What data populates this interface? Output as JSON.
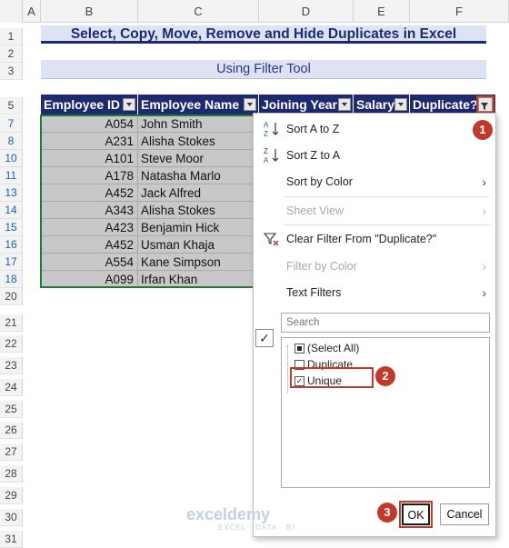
{
  "columns": [
    "A",
    "B",
    "C",
    "D",
    "E",
    "F"
  ],
  "rows": [
    "1",
    "2",
    "3",
    "5",
    "7",
    "8",
    "10",
    "11",
    "13",
    "14",
    "15",
    "16",
    "17",
    "18",
    "20",
    "21",
    "22",
    "23",
    "24",
    "25",
    "26",
    "27",
    "28",
    "29",
    "30",
    "31"
  ],
  "title": "Select, Copy, Move, Remove and Hide Duplicates in Excel",
  "subtitle": "Using Filter Tool",
  "headers": [
    "Employee ID",
    "Employee Name",
    "Joining Year",
    "Salary",
    "Duplicate?"
  ],
  "table": [
    {
      "id": "A054",
      "name": "John Smith"
    },
    {
      "id": "A231",
      "name": "Alisha Stokes"
    },
    {
      "id": "A101",
      "name": "Steve Moor"
    },
    {
      "id": "A178",
      "name": "Natasha Marlo"
    },
    {
      "id": "A452",
      "name": "Jack Alfred"
    },
    {
      "id": "A343",
      "name": "Alisha Stokes"
    },
    {
      "id": "A423",
      "name": "Benjamin Hick"
    },
    {
      "id": "A452",
      "name": "Usman Khaja"
    },
    {
      "id": "A554",
      "name": "Kane Simpson"
    },
    {
      "id": "A099",
      "name": "Irfan Khan"
    }
  ],
  "menu": {
    "sort_az": "Sort A to Z",
    "sort_za": "Sort Z to A",
    "sort_color": "Sort by Color",
    "sheet_view": "Sheet View",
    "clear_filter": "Clear Filter From \"Duplicate?\"",
    "filter_color": "Filter by Color",
    "text_filters": "Text Filters",
    "search_placeholder": "Search",
    "list": [
      {
        "label": "(Select All)",
        "state": "partial"
      },
      {
        "label": "Duplicate",
        "state": "unchecked"
      },
      {
        "label": "Unique",
        "state": "checked"
      }
    ],
    "ok": "OK",
    "cancel": "Cancel"
  },
  "badges": [
    "1",
    "2",
    "3"
  ],
  "watermark": {
    "brand": "exceldemy",
    "tagline": "EXCEL · DATA · BI"
  },
  "accent_colors": {
    "header": "#1f2a6e",
    "highlight": "#c0392b",
    "table_border": "#1f7a3a"
  }
}
